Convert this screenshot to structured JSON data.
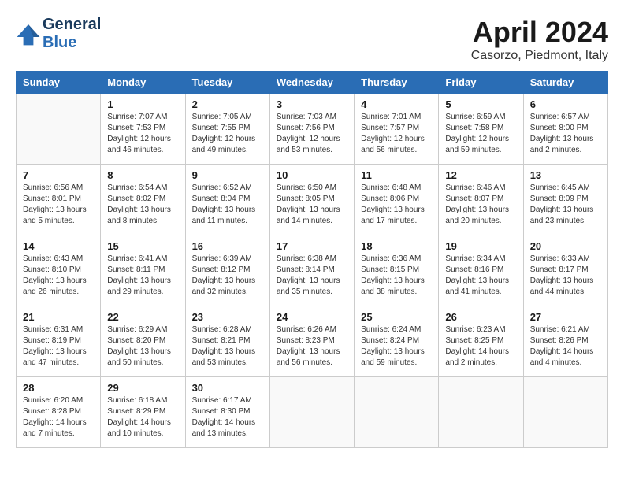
{
  "header": {
    "logo_line1": "General",
    "logo_line2": "Blue",
    "month": "April 2024",
    "location": "Casorzo, Piedmont, Italy"
  },
  "days_of_week": [
    "Sunday",
    "Monday",
    "Tuesday",
    "Wednesday",
    "Thursday",
    "Friday",
    "Saturday"
  ],
  "weeks": [
    [
      {
        "day": "",
        "info": ""
      },
      {
        "day": "1",
        "info": "Sunrise: 7:07 AM\nSunset: 7:53 PM\nDaylight: 12 hours\nand 46 minutes."
      },
      {
        "day": "2",
        "info": "Sunrise: 7:05 AM\nSunset: 7:55 PM\nDaylight: 12 hours\nand 49 minutes."
      },
      {
        "day": "3",
        "info": "Sunrise: 7:03 AM\nSunset: 7:56 PM\nDaylight: 12 hours\nand 53 minutes."
      },
      {
        "day": "4",
        "info": "Sunrise: 7:01 AM\nSunset: 7:57 PM\nDaylight: 12 hours\nand 56 minutes."
      },
      {
        "day": "5",
        "info": "Sunrise: 6:59 AM\nSunset: 7:58 PM\nDaylight: 12 hours\nand 59 minutes."
      },
      {
        "day": "6",
        "info": "Sunrise: 6:57 AM\nSunset: 8:00 PM\nDaylight: 13 hours\nand 2 minutes."
      }
    ],
    [
      {
        "day": "7",
        "info": "Sunrise: 6:56 AM\nSunset: 8:01 PM\nDaylight: 13 hours\nand 5 minutes."
      },
      {
        "day": "8",
        "info": "Sunrise: 6:54 AM\nSunset: 8:02 PM\nDaylight: 13 hours\nand 8 minutes."
      },
      {
        "day": "9",
        "info": "Sunrise: 6:52 AM\nSunset: 8:04 PM\nDaylight: 13 hours\nand 11 minutes."
      },
      {
        "day": "10",
        "info": "Sunrise: 6:50 AM\nSunset: 8:05 PM\nDaylight: 13 hours\nand 14 minutes."
      },
      {
        "day": "11",
        "info": "Sunrise: 6:48 AM\nSunset: 8:06 PM\nDaylight: 13 hours\nand 17 minutes."
      },
      {
        "day": "12",
        "info": "Sunrise: 6:46 AM\nSunset: 8:07 PM\nDaylight: 13 hours\nand 20 minutes."
      },
      {
        "day": "13",
        "info": "Sunrise: 6:45 AM\nSunset: 8:09 PM\nDaylight: 13 hours\nand 23 minutes."
      }
    ],
    [
      {
        "day": "14",
        "info": "Sunrise: 6:43 AM\nSunset: 8:10 PM\nDaylight: 13 hours\nand 26 minutes."
      },
      {
        "day": "15",
        "info": "Sunrise: 6:41 AM\nSunset: 8:11 PM\nDaylight: 13 hours\nand 29 minutes."
      },
      {
        "day": "16",
        "info": "Sunrise: 6:39 AM\nSunset: 8:12 PM\nDaylight: 13 hours\nand 32 minutes."
      },
      {
        "day": "17",
        "info": "Sunrise: 6:38 AM\nSunset: 8:14 PM\nDaylight: 13 hours\nand 35 minutes."
      },
      {
        "day": "18",
        "info": "Sunrise: 6:36 AM\nSunset: 8:15 PM\nDaylight: 13 hours\nand 38 minutes."
      },
      {
        "day": "19",
        "info": "Sunrise: 6:34 AM\nSunset: 8:16 PM\nDaylight: 13 hours\nand 41 minutes."
      },
      {
        "day": "20",
        "info": "Sunrise: 6:33 AM\nSunset: 8:17 PM\nDaylight: 13 hours\nand 44 minutes."
      }
    ],
    [
      {
        "day": "21",
        "info": "Sunrise: 6:31 AM\nSunset: 8:19 PM\nDaylight: 13 hours\nand 47 minutes."
      },
      {
        "day": "22",
        "info": "Sunrise: 6:29 AM\nSunset: 8:20 PM\nDaylight: 13 hours\nand 50 minutes."
      },
      {
        "day": "23",
        "info": "Sunrise: 6:28 AM\nSunset: 8:21 PM\nDaylight: 13 hours\nand 53 minutes."
      },
      {
        "day": "24",
        "info": "Sunrise: 6:26 AM\nSunset: 8:23 PM\nDaylight: 13 hours\nand 56 minutes."
      },
      {
        "day": "25",
        "info": "Sunrise: 6:24 AM\nSunset: 8:24 PM\nDaylight: 13 hours\nand 59 minutes."
      },
      {
        "day": "26",
        "info": "Sunrise: 6:23 AM\nSunset: 8:25 PM\nDaylight: 14 hours\nand 2 minutes."
      },
      {
        "day": "27",
        "info": "Sunrise: 6:21 AM\nSunset: 8:26 PM\nDaylight: 14 hours\nand 4 minutes."
      }
    ],
    [
      {
        "day": "28",
        "info": "Sunrise: 6:20 AM\nSunset: 8:28 PM\nDaylight: 14 hours\nand 7 minutes."
      },
      {
        "day": "29",
        "info": "Sunrise: 6:18 AM\nSunset: 8:29 PM\nDaylight: 14 hours\nand 10 minutes."
      },
      {
        "day": "30",
        "info": "Sunrise: 6:17 AM\nSunset: 8:30 PM\nDaylight: 14 hours\nand 13 minutes."
      },
      {
        "day": "",
        "info": ""
      },
      {
        "day": "",
        "info": ""
      },
      {
        "day": "",
        "info": ""
      },
      {
        "day": "",
        "info": ""
      }
    ]
  ]
}
